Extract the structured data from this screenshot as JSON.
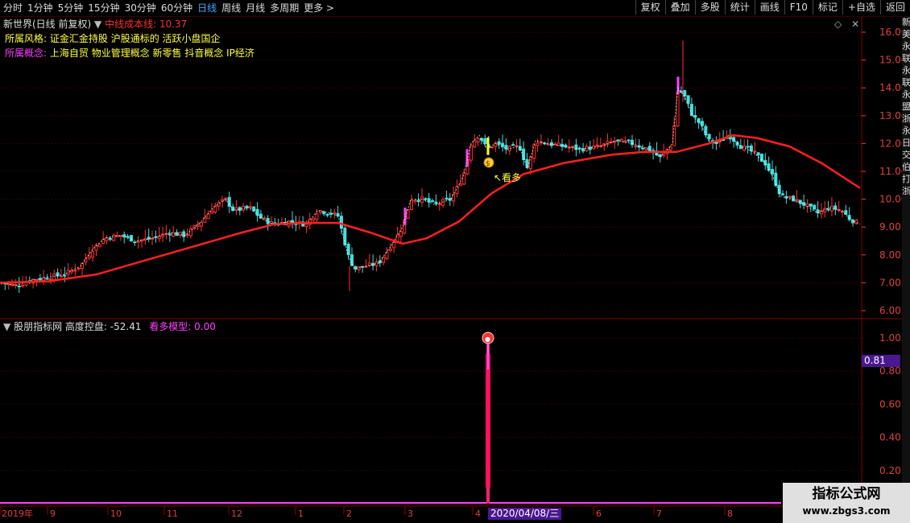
{
  "toolbar": {
    "periods": [
      "分时",
      "1分钟",
      "5分钟",
      "15分钟",
      "30分钟",
      "60分钟",
      "日线",
      "周线",
      "月线",
      "多周期",
      "更多 >"
    ],
    "active": "日线",
    "actions": [
      "复权",
      "叠加",
      "多股",
      "统计",
      "画线",
      "F10",
      "标记",
      "+自选",
      "返回"
    ]
  },
  "price_panel": {
    "title": "新世界(日线 前复权)",
    "ma_label": "中线成本线:",
    "ma_value": "10.37",
    "style_label": "所属风格:",
    "style_value": "证金汇金持股 沪股通标的 活跃小盘国企",
    "concept_label": "所属概念:",
    "concept_value": "上海自贸 物业管理概念 新零售 抖音概念 IP经济",
    "annotation": "↖看多",
    "annotation_icon": "money-bag-icon"
  },
  "indicator_panel": {
    "source": "股朋指标网",
    "name_label": "高度控盘:",
    "name_value": "-52.41",
    "model_label": "看多模型:",
    "model_value": "0.00",
    "cursor_value": "0.81",
    "peak_icon": "badge-icon"
  },
  "date_axis": {
    "labels": [
      "2019年",
      "9",
      "10",
      "11",
      "12",
      "1",
      "2",
      "3",
      "4",
      "5",
      "6",
      "7",
      "8"
    ],
    "cursor": "2020/04/08/三"
  },
  "right_rail_text": [
    "新",
    "美",
    "永",
    "联",
    "永",
    "联",
    "永",
    "盟",
    "浙",
    "永",
    "日",
    "交",
    "伯",
    "打",
    "浙"
  ],
  "watermark": {
    "line1": "指标公式网",
    "line2": "www.zbgs3.com"
  },
  "colors": {
    "up": "#ff3030",
    "down": "#40e0e0",
    "ma": "#ff2020",
    "signal": "#ff40ff",
    "grid": "#5a0000",
    "axis_text": "#e04040"
  },
  "chart_data": [
    {
      "type": "candlestick",
      "yaxis": {
        "min": 6.0,
        "max": 16.0,
        "ticks": [
          6.0,
          7.0,
          8.0,
          9.0,
          10.0,
          11.0,
          12.0,
          13.0,
          14.0,
          15.0,
          16.0
        ]
      },
      "close_path": [
        [
          0,
          7.0
        ],
        [
          20,
          6.9
        ],
        [
          40,
          7.1
        ],
        [
          60,
          7.2
        ],
        [
          80,
          7.3
        ],
        [
          100,
          7.6
        ],
        [
          115,
          8.2
        ],
        [
          130,
          8.6
        ],
        [
          150,
          8.7
        ],
        [
          170,
          8.5
        ],
        [
          190,
          8.6
        ],
        [
          210,
          8.8
        ],
        [
          230,
          8.7
        ],
        [
          250,
          9.2
        ],
        [
          265,
          9.7
        ],
        [
          280,
          10.0
        ],
        [
          290,
          9.6
        ],
        [
          310,
          9.7
        ],
        [
          325,
          9.3
        ],
        [
          340,
          9.1
        ],
        [
          360,
          9.2
        ],
        [
          380,
          9.1
        ],
        [
          395,
          9.6
        ],
        [
          410,
          9.5
        ],
        [
          420,
          9.4
        ],
        [
          432,
          8.0
        ],
        [
          440,
          7.5
        ],
        [
          455,
          7.6
        ],
        [
          470,
          7.7
        ],
        [
          485,
          8.3
        ],
        [
          500,
          9.0
        ],
        [
          510,
          10.0
        ],
        [
          525,
          10.0
        ],
        [
          540,
          9.8
        ],
        [
          560,
          10.0
        ],
        [
          575,
          10.8
        ],
        [
          585,
          12.0
        ],
        [
          595,
          12.3
        ],
        [
          605,
          11.8
        ],
        [
          615,
          12.0
        ],
        [
          630,
          11.8
        ],
        [
          645,
          11.9
        ],
        [
          655,
          11.1
        ],
        [
          665,
          12.1
        ],
        [
          680,
          12.0
        ],
        [
          700,
          11.9
        ],
        [
          720,
          11.8
        ],
        [
          745,
          11.9
        ],
        [
          765,
          12.1
        ],
        [
          785,
          12.0
        ],
        [
          805,
          11.8
        ],
        [
          820,
          11.5
        ],
        [
          835,
          12.0
        ],
        [
          842,
          14.0
        ],
        [
          850,
          13.7
        ],
        [
          860,
          13.0
        ],
        [
          870,
          12.7
        ],
        [
          880,
          12.1
        ],
        [
          890,
          12.0
        ],
        [
          905,
          12.3
        ],
        [
          920,
          11.9
        ],
        [
          935,
          11.7
        ],
        [
          950,
          11.3
        ],
        [
          960,
          10.8
        ],
        [
          970,
          10.1
        ],
        [
          985,
          10.0
        ],
        [
          1000,
          9.8
        ],
        [
          1015,
          9.5
        ],
        [
          1030,
          9.7
        ],
        [
          1045,
          9.6
        ],
        [
          1055,
          9.3
        ],
        [
          1068,
          9.1
        ]
      ],
      "ma_path": [
        [
          0,
          7.0
        ],
        [
          60,
          7.05
        ],
        [
          120,
          7.3
        ],
        [
          180,
          7.8
        ],
        [
          240,
          8.3
        ],
        [
          300,
          8.8
        ],
        [
          340,
          9.1
        ],
        [
          380,
          9.15
        ],
        [
          420,
          9.15
        ],
        [
          460,
          8.8
        ],
        [
          500,
          8.4
        ],
        [
          530,
          8.6
        ],
        [
          570,
          9.2
        ],
        [
          610,
          10.2
        ],
        [
          650,
          10.9
        ],
        [
          700,
          11.3
        ],
        [
          760,
          11.6
        ],
        [
          800,
          11.7
        ],
        [
          840,
          11.7
        ],
        [
          880,
          12.0
        ],
        [
          910,
          12.3
        ],
        [
          940,
          12.2
        ],
        [
          980,
          11.9
        ],
        [
          1020,
          11.3
        ],
        [
          1068,
          10.4
        ]
      ],
      "signal_bars_x": [
        503,
        580,
        842,
        606
      ]
    },
    {
      "type": "bar",
      "yaxis": {
        "min": 0.0,
        "max": 1.0,
        "ticks": [
          0.2,
          0.4,
          0.6,
          0.8,
          1.0
        ]
      },
      "spike": {
        "date": "2020/04/08",
        "value": 1.0
      }
    }
  ]
}
